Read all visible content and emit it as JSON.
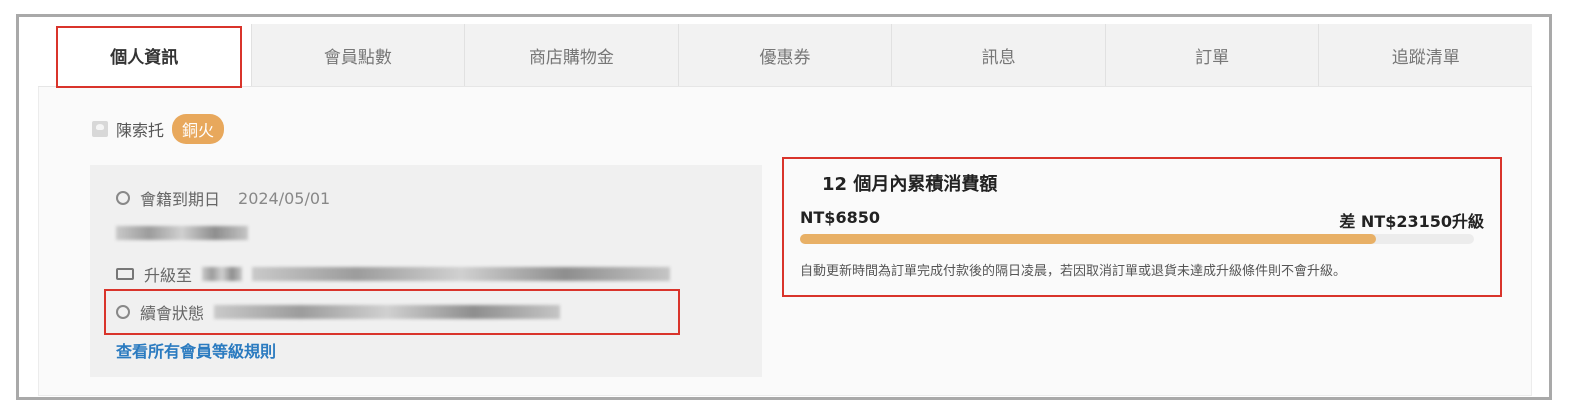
{
  "tabs": [
    {
      "label": "個人資訊",
      "active": true
    },
    {
      "label": "會員點數",
      "active": false
    },
    {
      "label": "商店購物金",
      "active": false
    },
    {
      "label": "優惠券",
      "active": false
    },
    {
      "label": "訊息",
      "active": false
    },
    {
      "label": "訂單",
      "active": false
    },
    {
      "label": "追蹤清單",
      "active": false
    }
  ],
  "user": {
    "name": "陳索托",
    "tier_badge": "銅火"
  },
  "membership": {
    "expiry_label": "會籍到期日",
    "expiry_date": "2024/05/01",
    "upgrade_label": "升級至",
    "renewal_label": "續會狀態",
    "rules_link": "查看所有會員等級規則"
  },
  "spending": {
    "title": "12 個月內累積消費額",
    "amount": "NT$6850",
    "difference": "差 NT$23150升級",
    "progress": 0.855,
    "note": "自動更新時間為訂單完成付款後的隔日凌晨，若因取消訂單或退貨未達成升級條件則不會升級。"
  },
  "colors": {
    "accent": "#e8b066",
    "badge": "#e8a85c",
    "link": "#2b7bc0",
    "highlight": "#d9342b"
  }
}
